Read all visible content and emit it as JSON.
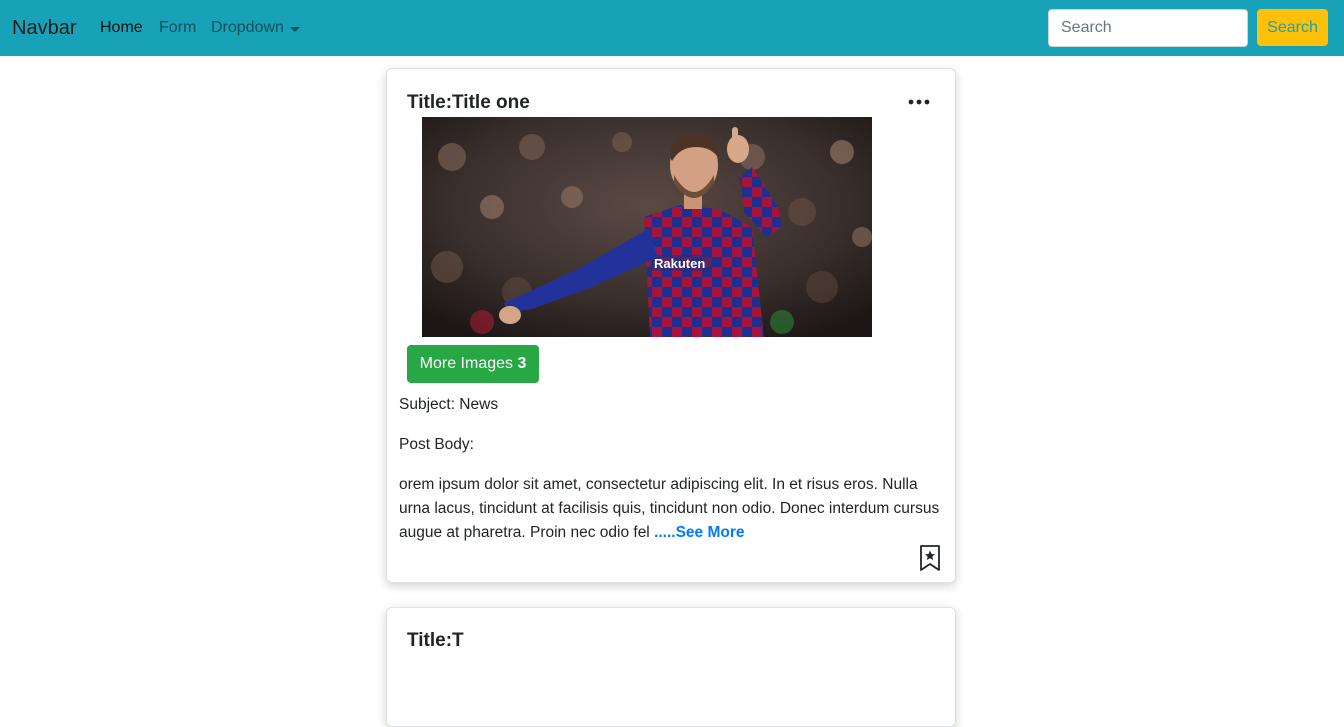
{
  "navbar": {
    "brand": "Navbar",
    "links": [
      {
        "label": "Home",
        "active": true
      },
      {
        "label": "Form",
        "active": false
      },
      {
        "label": "Dropdown",
        "active": false
      }
    ],
    "search_placeholder": "Search",
    "search_button_label": "Search",
    "background_color": "#17a2b8",
    "button_color": "#ffc107"
  },
  "post": {
    "title": "Title:Title one",
    "more_images_label": "More Images ",
    "more_images_count": "3",
    "subject": "Subject: News",
    "body_label": "Post Body:",
    "body_text": "orem ipsum dolor sit amet, consectetur adipiscing elit. In et risus eros. Nulla urna lacus, tincidunt at facilisis quis, tincidunt non odio. Donec interdum cursus augue at pharetra. Proin nec odio fel ",
    "see_more_label": ".....See More",
    "icons": {
      "options": "ellipsis-icon",
      "bookmark": "bookmark-star-icon"
    }
  },
  "next_post": {
    "title": "Title:T"
  }
}
